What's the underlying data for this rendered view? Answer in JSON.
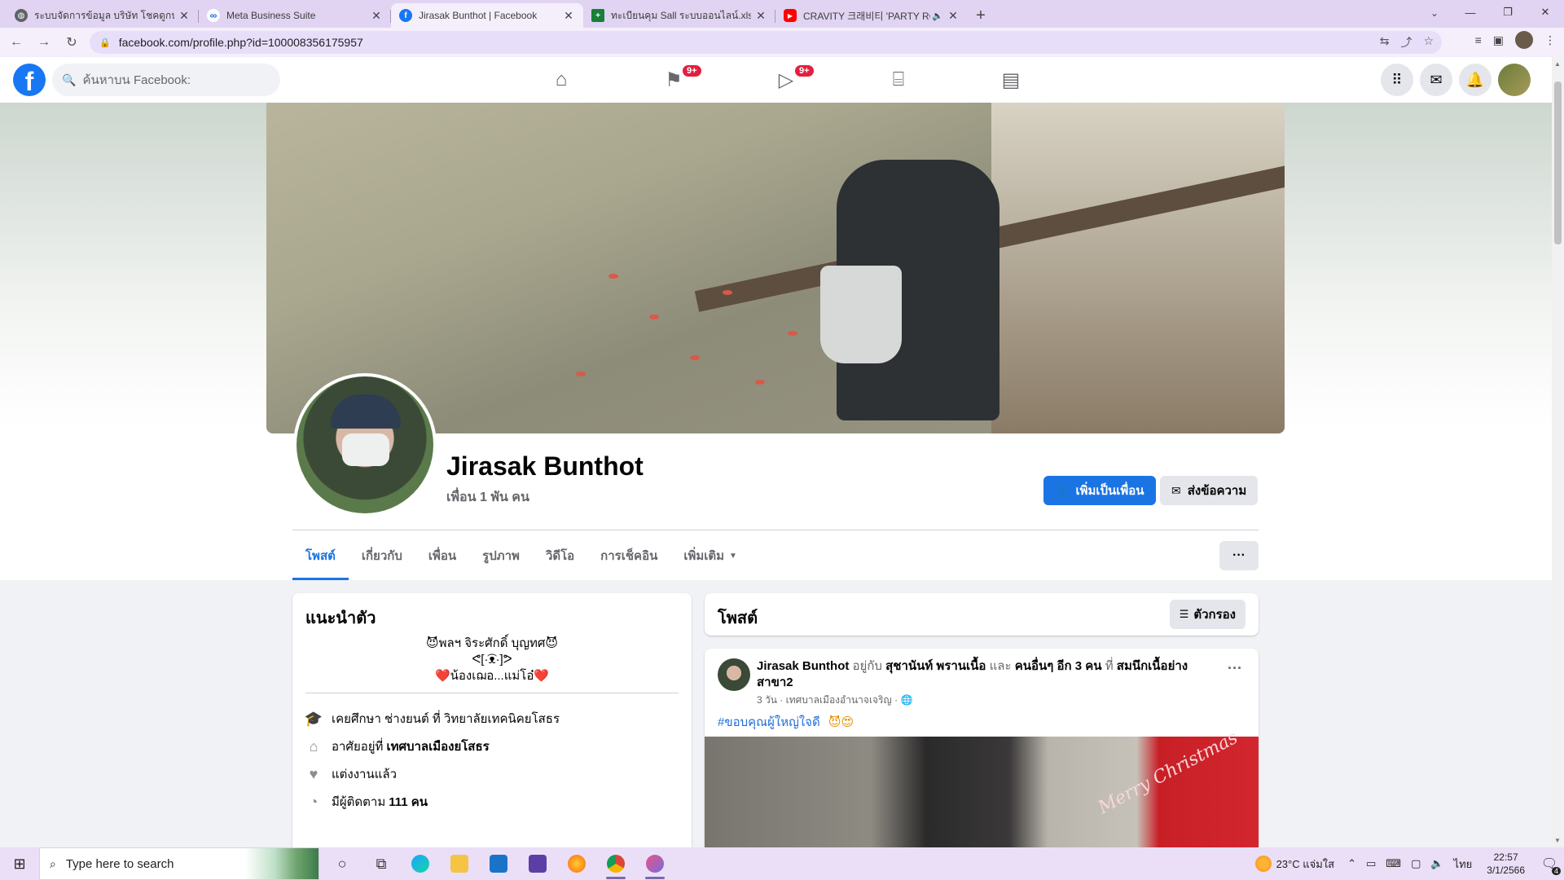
{
  "browser": {
    "tabs": [
      {
        "title": "ระบบจัดการข้อมูล บริษัท โชคดูกน์โชค",
        "favicon": "globe-icon",
        "active": false
      },
      {
        "title": "Meta Business Suite",
        "favicon": "meta-icon",
        "active": false
      },
      {
        "title": "Jirasak Bunthot | Facebook",
        "favicon": "facebook-icon",
        "active": true
      },
      {
        "title": "ทะเบียนคุม Sall ระบบออนไลน์.xlsx - G",
        "favicon": "sheets-icon",
        "active": false
      },
      {
        "title": "CRAVITY 크래비티 'PARTY RO",
        "favicon": "youtube-icon",
        "active": false
      }
    ],
    "url": "facebook.com/profile.php?id=100008356175957",
    "tab_strip_color": "#e1d4f2"
  },
  "fb": {
    "search_placeholder": "ค้นหาบน Facebook:",
    "nav": [
      {
        "name": "home",
        "icon": "home-icon",
        "badge": ""
      },
      {
        "name": "pages",
        "icon": "flag-icon",
        "badge": "9+"
      },
      {
        "name": "watch",
        "icon": "video-icon",
        "badge": "9+"
      },
      {
        "name": "marketplace",
        "icon": "store-icon",
        "badge": ""
      },
      {
        "name": "gaming",
        "icon": "gaming-icon",
        "badge": ""
      }
    ],
    "brand_color": "#1877f2"
  },
  "profile": {
    "name": "Jirasak Bunthot",
    "friends": "เพื่อน 1 พัน คน",
    "add_friend": "เพิ่มเป็นเพื่อน",
    "message": "ส่งข้อความ",
    "tabs": [
      "โพสต์",
      "เกี่ยวกับ",
      "เพื่อน",
      "รูปภาพ",
      "วิดีโอ",
      "การเช็คอิน",
      "เพิ่มเติม"
    ],
    "more_dots": "···"
  },
  "intro": {
    "title": "แนะนำตัว",
    "bio": [
      "😈พลฯ จิระศักดิ์ บุญทศ😈",
      "ᕙ[·͡ᴥ·]ᕗ",
      "❤️น้องเฌอ...แม่โอ๋❤️"
    ],
    "studied": {
      "text": "เคยศึกษา ช่างยนต์ ที่ วิทยาลัยเทคนิคยโสธร"
    },
    "lives": {
      "prefix": "อาศัยอยู่ที่",
      "place": "เทศบาลเมืองยโสธร"
    },
    "relationship": "แต่งงานแล้ว",
    "followers": {
      "prefix": "มีผู้ติดตาม",
      "count": "111 คน"
    }
  },
  "posts": {
    "title": "โพสต์",
    "filter": "ตัวกรอง",
    "first": {
      "author": "Jirasak Bunthot",
      "with_word": "อยู่กับ",
      "tagged": "สุชานันท์ พรานเนื้อ",
      "and_word": "และ",
      "others": "คนอื่นๆ อีก 3 คน",
      "at_word": "ที่",
      "place": "สมนึกเนื้อย่าง สาขา2",
      "time": "3 วัน · เทศบาลเมืองอำนาจเจริญ ·",
      "hashtag": "#ขอบคุณผู้ใหญ่ใจดี",
      "emoji": "😈😍",
      "photo_text": "Merry Christmas"
    }
  },
  "taskbar": {
    "search": "Type here to search",
    "weather": "23°C  แจ่มใส",
    "lang": "ไทย",
    "time": "22:57",
    "date": "3/1/2566",
    "notifications": "4"
  }
}
